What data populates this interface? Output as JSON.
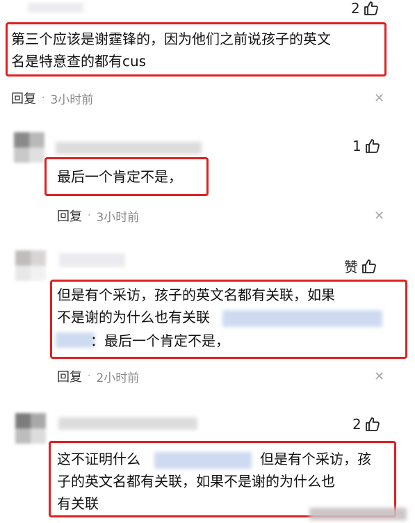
{
  "comments": [
    {
      "likes": "2",
      "text": "第三个应该是谢霆锋的，因为他们之前说孩子的英文\n名是特意查的都有cus",
      "reply_label": "回复",
      "dot": "·",
      "time": "3小时前"
    },
    {
      "likes": "1",
      "text": "最后一个肯定不是，",
      "reply_label": "回复",
      "dot": "·",
      "time": "3小时前"
    },
    {
      "likes": "赞",
      "text_line1": "但是有个采访，孩子的英文名都有关联，如果",
      "text_line2": "不是谢的为什么也有关联",
      "text_line3": "：最后一个肯定不是，",
      "reply_label": "回复",
      "dot": "·",
      "time": "2小时前"
    },
    {
      "likes": "2",
      "text_line1a": "这不证明什么",
      "text_line1b": "但是有个采访，孩",
      "text_line2": "子的英文名都有关联，如果不是谢的为什么也",
      "text_line3": "有关联"
    }
  ],
  "icons": {
    "like": "thumbs-up-icon",
    "close": "close-icon"
  },
  "colors": {
    "highlight": "#e02020"
  }
}
